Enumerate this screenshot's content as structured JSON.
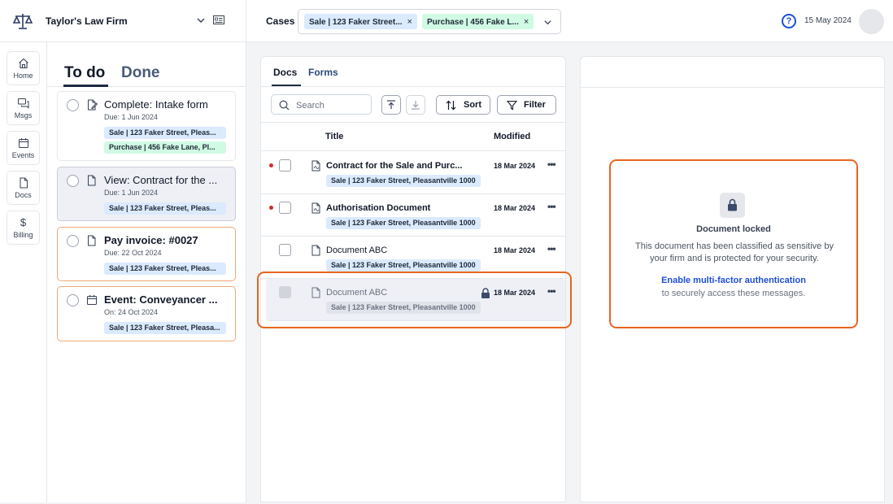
{
  "header": {
    "firm_name": "Taylor's Law Firm",
    "cases_label": "Cases",
    "case_chips": [
      {
        "label": "Sale | 123 Faker Street...",
        "remove": "×"
      },
      {
        "label": "Purchase | 456 Fake L...",
        "remove": "×"
      }
    ],
    "help_label": "?",
    "date": "15 May 2024"
  },
  "rail": {
    "items": [
      {
        "label": "Home",
        "icon": "home-icon"
      },
      {
        "label": "Msgs",
        "icon": "messages-icon"
      },
      {
        "label": "Events",
        "icon": "calendar-icon"
      },
      {
        "label": "Docs",
        "icon": "document-icon"
      },
      {
        "label": "Billing",
        "icon": "dollar-icon"
      }
    ],
    "billing_glyph": "$"
  },
  "todo": {
    "tabs": {
      "active": "To do",
      "inactive": "Done"
    },
    "tasks": [
      {
        "title": "Complete: Intake form",
        "due": "Due: 1 Jun 2024",
        "chips": [
          "Sale | 123 Faker Street, Pleas...",
          "Purchase | 456 Fake Lane, Pl..."
        ]
      },
      {
        "title": "View: Contract for the ...",
        "due": "Due: 1 Jun 2024",
        "chips": [
          "Sale | 123 Faker Street, Pleas..."
        ]
      },
      {
        "title": "Pay invoice: #0027",
        "due": "Due: 22 Oct 2024",
        "chips": [
          "Sale | 123 Faker Street, Pleas..."
        ]
      },
      {
        "title": "Event: Conveyancer ...",
        "due": "On: 24 Oct 2024",
        "chips": [
          "Sale | 123 Faker Street, Pleasa..."
        ]
      }
    ]
  },
  "docs": {
    "tabs": {
      "active": "Docs",
      "inactive": "Forms"
    },
    "search_placeholder": "Search",
    "sort_label": "Sort",
    "filter_label": "Filter",
    "columns": {
      "title": "Title",
      "modified": "Modified"
    },
    "rows": [
      {
        "title": "Contract for the Sale and Purc...",
        "chip": "Sale | 123 Faker Street, Pleasantville 1000",
        "date": "18 Mar 2024",
        "more": "•••"
      },
      {
        "title": "Authorisation Document",
        "chip": "Sale | 123 Faker Street, Pleasantville 1000",
        "date": "18 Mar 2024",
        "more": "•••"
      },
      {
        "title": "Document ABC",
        "chip": "Sale | 123 Faker Street, Pleasantville 1000",
        "date": "18 Mar 2024",
        "more": "•••"
      },
      {
        "title": "Document ABC",
        "chip": "Sale | 123 Faker Street, Pleasantville 1000",
        "date": "18 Mar 2024",
        "more": "•••"
      }
    ]
  },
  "preview": {
    "locked_title": "Document locked",
    "locked_desc": "This document has been classified as sensitive by your firm and is protected for your security.",
    "mfa_link": "Enable multi-factor authentication",
    "mfa_sub": "to securely access these messages."
  },
  "colors": {
    "accent": "#1d4ed8",
    "highlight": "#e8651f",
    "sale_chip": "#dbeafe",
    "purchase_chip": "#d1fae5",
    "unread_dot": "#dc2626"
  }
}
